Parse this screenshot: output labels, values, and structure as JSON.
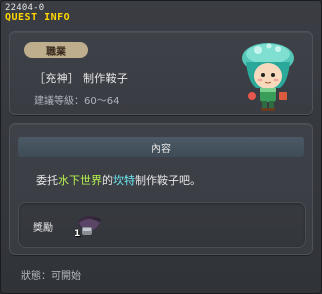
{
  "window": {
    "quest_id": "22404-0",
    "title": "QUEST INFO"
  },
  "job": {
    "badge": "職業",
    "name": "［充神］ 制作鞍子",
    "level_text": "建議等級：60～64"
  },
  "content": {
    "header": "內容",
    "desc_prefix": "委托",
    "desc_place": "水下世界",
    "desc_mid": "的",
    "desc_npc": "坎特",
    "desc_suffix": "制作鞍子吧。"
  },
  "reward": {
    "label": "獎勵",
    "item_icon": "saddle-item-icon",
    "item_quantity": "1"
  },
  "status": {
    "text": "狀態：可開始"
  },
  "colors": {
    "title": "#ffd600",
    "place_highlight": "#b9f24f",
    "npc_highlight": "#6fe8f2",
    "badge": "#bfae8e"
  }
}
